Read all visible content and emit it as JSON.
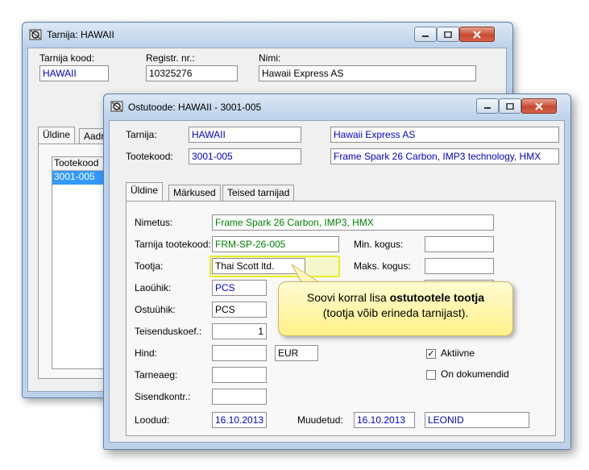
{
  "supplier_window": {
    "title": "Tarnija: HAWAII",
    "code_label": "Tarnija kood:",
    "code_value": "HAWAII",
    "reg_label": "Registr. nr.:",
    "reg_value": "10325276",
    "name_label": "Nimi:",
    "name_value": "Hawaii Express AS",
    "tabs": [
      "Üldine",
      "Aadr"
    ],
    "list_header": "Tootekood",
    "list_items": [
      "3001-005"
    ]
  },
  "product_window": {
    "title": "Ostutoode: HAWAII - 3001-005",
    "supplier_label": "Tarnija:",
    "supplier_code": "HAWAII",
    "supplier_name": "Hawaii Express AS",
    "product_code_label": "Tootekood:",
    "product_code": "3001-005",
    "product_name": "Frame Spark 26 Carbon, IMP3 technology, HMX",
    "tabs": [
      "Üldine",
      "Märkused",
      "Teised tarnijad"
    ],
    "form": {
      "name_label": "Nimetus:",
      "name_value": "Frame Spark 26 Carbon, IMP3, HMX",
      "supplier_product_code_label": "Tarnija tootekood:",
      "supplier_product_code_value": "FRM-SP-26-005",
      "manufacturer_label": "Tootja:",
      "manufacturer_value": "Thai Scott ltd.",
      "stock_unit_label": "Laoühik:",
      "stock_unit_value": "PCS",
      "purchase_unit_label": "Ostuühik:",
      "purchase_unit_value": "PCS",
      "conversion_label": "Teisenduskoef.:",
      "conversion_value": "1",
      "price_label": "Hind:",
      "currency_value": "EUR",
      "delivery_label": "Tarneaeg:",
      "input_control_label": "Sisendkontr.:",
      "created_label": "Loodud:",
      "created_value": "16.10.2013",
      "modified_label": "Muudetud:",
      "modified_value": "16.10.2013",
      "modified_by": "LEONID",
      "min_qty_label": "Min. kogus:",
      "max_qty_label": "Maks. kogus:",
      "active_label": "Aktiivne",
      "active_checked": true,
      "on_documents_label": "On dokumendid",
      "on_documents_checked": false
    }
  },
  "callout": {
    "line1_prefix": "Soovi korral lisa ",
    "line1_bold": "ostutootele tootja",
    "line2": "(tootja võib erineda tarnijast)."
  }
}
